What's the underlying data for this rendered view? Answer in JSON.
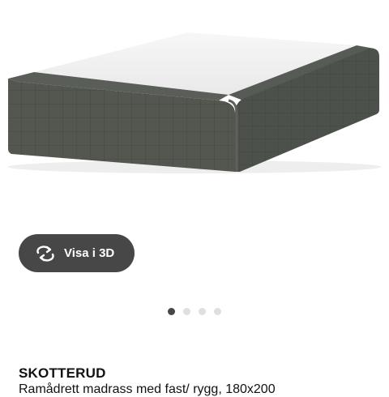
{
  "product": {
    "name": "SKOTTERUD",
    "description": "Ramådrett madrass med fast/ rygg, 180x200"
  },
  "viewer": {
    "button_label": "Visa i 3D",
    "button_icon": "rotate-arrows-icon",
    "carousel": {
      "count": 4,
      "active_index": 0
    }
  },
  "colors": {
    "button_bg": "#474747",
    "dot_active": "#484848",
    "dot_inactive": "#dfdfdf",
    "fabric": "#505550",
    "top_panel": "#f3f3f3"
  }
}
